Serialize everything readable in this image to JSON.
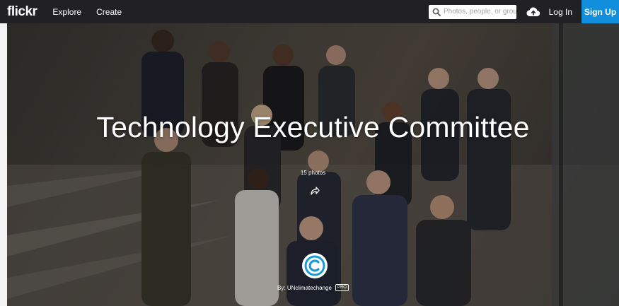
{
  "topbar": {
    "logo": "flickr",
    "nav": [
      "Explore",
      "Create"
    ],
    "search_placeholder": "Photos, people, or groups",
    "login_label": "Log In",
    "signup_label": "Sign Up"
  },
  "album": {
    "title": "Technology Executive Committee",
    "photo_count": "15 photos",
    "by_label": "By: UNclimatechange",
    "pro_badge": "PRO"
  },
  "colors": {
    "topbar_bg": "#212124",
    "signup_bg": "#128fdc",
    "avatar_ring": "#1b9ad6"
  },
  "icons": [
    "search-icon",
    "upload-cloud-icon",
    "share-icon",
    "owner-avatar-icon"
  ]
}
